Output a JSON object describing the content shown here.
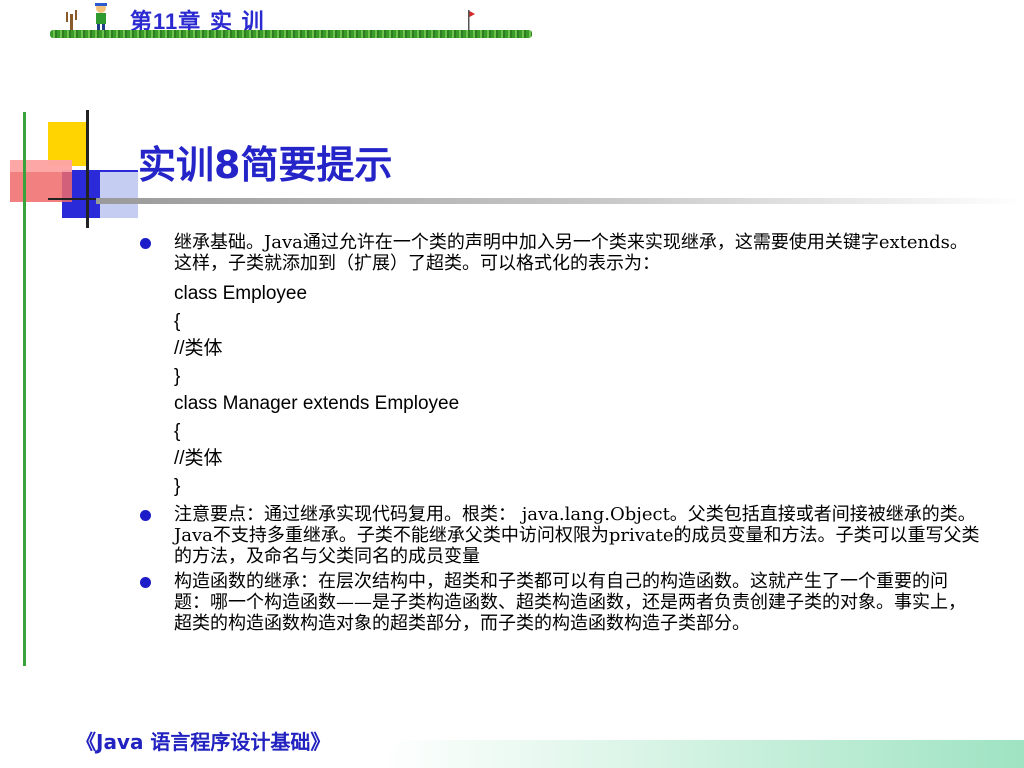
{
  "header": {
    "chapter_prefix": "第",
    "chapter_num": "11",
    "chapter_suffix": "章  实 训"
  },
  "title": {
    "prefix": "实训",
    "num": "8",
    "suffix": "简要提示"
  },
  "bullets": [
    {
      "line1": "继承基础。Java通过允许在一个类的声明中加入另一个类来实现继承，这需要使用关键字extends。这样，子类就添加到（扩展）了超类。可以格式化的表示为：",
      "code": [
        "class Employee",
        "{",
        "//类体",
        "}",
        "class Manager extends Employee",
        "{",
        "//类体",
        "}"
      ]
    },
    {
      "line1": "注意要点：通过继承实现代码复用。根类： java.lang.Object。父类包括直接或者间接被继承的类。Java不支持多重继承。子类不能继承父类中访问权限为private的成员变量和方法。子类可以重写父类的方法，及命名与父类同名的成员变量"
    },
    {
      "line1": "构造函数的继承：在层次结构中，超类和子类都可以有自己的构造函数。这就产生了一个重要的问题：哪一个构造函数——是子类构造函数、超类构造函数，还是两者负责创建子类的对象。事实上，超类的构造函数构造对象的超类部分，而子类的构造函数构造子类部分。"
    }
  ],
  "footer": {
    "text": "《Java 语言程序设计基础》"
  },
  "colors": {
    "accent": "#2424c8",
    "bullet": "#1c1cc8",
    "green": "#3aa23a"
  }
}
